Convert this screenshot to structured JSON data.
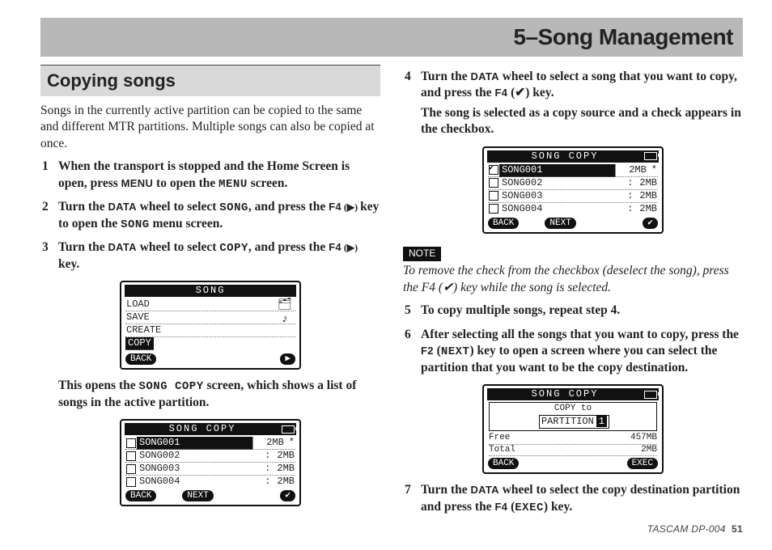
{
  "chapter": "5–Song Management",
  "section": "Copying songs",
  "intro": "Songs in the currently active partition can be copied to the same and different MTR partitions. Multiple songs can also be copied at once.",
  "step1": {
    "pre": "When the transport is stopped and the Home Screen is open, press ",
    "menu": "MENU",
    "mid": " to open the ",
    "menu_mono": "MENU",
    "post": " screen."
  },
  "step2": {
    "pre": "Turn the ",
    "data": "DATA",
    "mid1": " wheel to select ",
    "song": "SONG",
    "mid2": ", and press the ",
    "f4": "F4",
    "tri": " (▶) ",
    "mid3": "key to open the ",
    "song2": "SONG",
    "post": " menu screen."
  },
  "step3": {
    "pre": "Turn the ",
    "data": "DATA",
    "mid1": " wheel to select ",
    "copy": "COPY",
    "mid2": ", and press the ",
    "f4": "F4",
    "tri": " (▶) ",
    "post": "key."
  },
  "songmenu": {
    "title": "SONG",
    "items": [
      "LOAD",
      "SAVE",
      "CREATE",
      "COPY"
    ],
    "selected": "COPY",
    "back": "BACK",
    "rbtn": "▶"
  },
  "after_songmenu": {
    "pre": "This opens the ",
    "sc": "SONG COPY",
    "post": " screen, which shows a list of songs in the active partition."
  },
  "songcopy1": {
    "title": "SONG COPY",
    "rows": [
      {
        "checked": false,
        "name": "SONG001",
        "size": "2MB",
        "star": true,
        "sel": true
      },
      {
        "checked": false,
        "name": "SONG002",
        "size": "2MB",
        "star": false,
        "sel": false
      },
      {
        "checked": false,
        "name": "SONG003",
        "size": "2MB",
        "star": false,
        "sel": false
      },
      {
        "checked": false,
        "name": "SONG004",
        "size": "2MB",
        "star": false,
        "sel": false
      }
    ],
    "back": "BACK",
    "next": "NEXT",
    "check": "✔"
  },
  "step4": {
    "pre": "Turn the ",
    "data": "DATA",
    "mid1": " wheel to select a song that you want to copy, and press the ",
    "f4": "F4",
    "chk": " (✔) ",
    "post": "key."
  },
  "step4_follow": "The song is selected as a copy source and a check appears in the checkbox.",
  "songcopy2": {
    "title": "SONG COPY",
    "rows": [
      {
        "checked": true,
        "name": "SONG001",
        "size": "2MB",
        "star": true,
        "sel": true
      },
      {
        "checked": false,
        "name": "SONG002",
        "size": "2MB",
        "star": false,
        "sel": false
      },
      {
        "checked": false,
        "name": "SONG003",
        "size": "2MB",
        "star": false,
        "sel": false
      },
      {
        "checked": false,
        "name": "SONG004",
        "size": "2MB",
        "star": false,
        "sel": false
      }
    ],
    "back": "BACK",
    "next": "NEXT",
    "check": "✔"
  },
  "note_label": "NOTE",
  "note_text": "To remove the check from the checkbox (deselect the song), press the F4 (✔) key while the song is selected.",
  "step5": "To copy multiple songs, repeat step 4.",
  "step6": {
    "pre": "After selecting all the songs that you want to copy, press the ",
    "f2": "F2",
    "next_mono": "NEXT",
    "post": " key to open a screen where you can select the partition that you want to be the copy destination."
  },
  "songcopy3": {
    "title": "SONG COPY",
    "copyto": "COPY to",
    "partition": "PARTITION",
    "partnum": "1",
    "free_label": "Free",
    "free_val": "457MB",
    "total_label": "Total",
    "total_val": "2MB",
    "back": "BACK",
    "exec": "EXEC"
  },
  "step7": {
    "pre": "Turn the ",
    "data": "DATA",
    "mid": " wheel to select the copy destination partition and press the ",
    "f4": "F4",
    "exec_mono": "EXEC",
    "post": " key."
  },
  "footer_model": "TASCAM  DP-004",
  "footer_page": "51"
}
